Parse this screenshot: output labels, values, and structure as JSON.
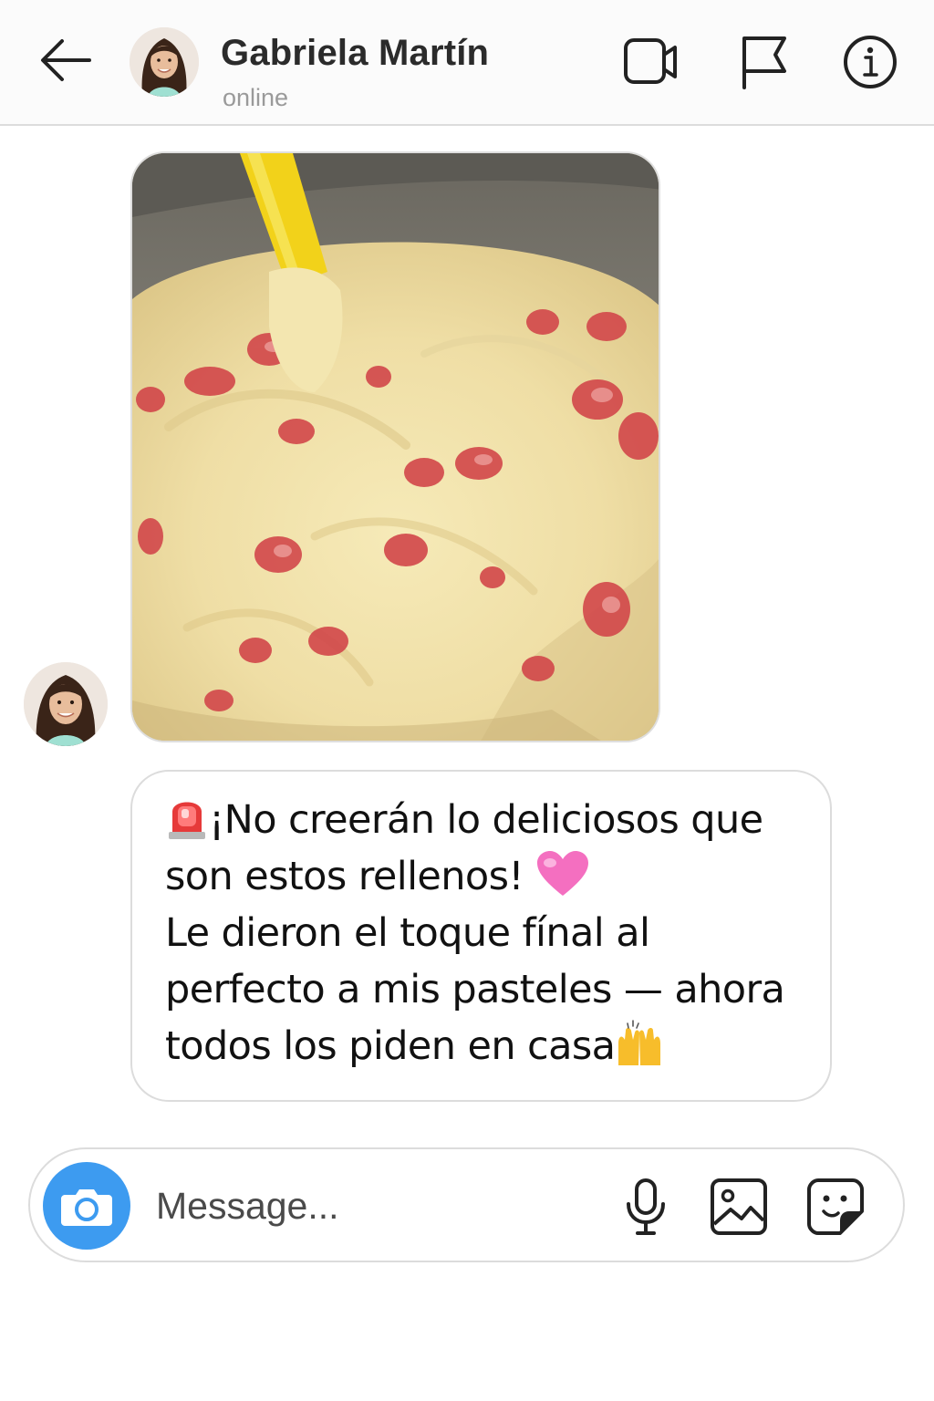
{
  "header": {
    "contact_name": "Gabriela Martín",
    "status": "online",
    "icons": [
      "back-arrow-icon",
      "video-camera-icon",
      "flag-icon",
      "info-icon"
    ]
  },
  "conversation": {
    "photo_message": {
      "image": "photo of cake batter with chopped strawberries in a steel bowl with a yellow spatula"
    },
    "text_message": {
      "lines": [
        "¡No creerán lo deliciosos que",
        "son estos rellenos!",
        "Le dieron el toque fínal al",
        "perfecto a mis pasteles — ahora",
        "todos los piden en casa"
      ],
      "emojis": [
        "siren-emoji",
        "pink-heart-emoji",
        "raised-hands-emoji"
      ]
    }
  },
  "composer": {
    "placeholder": "Message...",
    "icons": [
      "camera-icon",
      "microphone-icon",
      "gallery-icon",
      "sticker-icon"
    ]
  },
  "colors": {
    "accent": "#3d9bf0",
    "heart": "#f46fc0",
    "siren": "#e63a3a",
    "hands": "#f7bd2b",
    "spatula": "#f2d21a"
  }
}
